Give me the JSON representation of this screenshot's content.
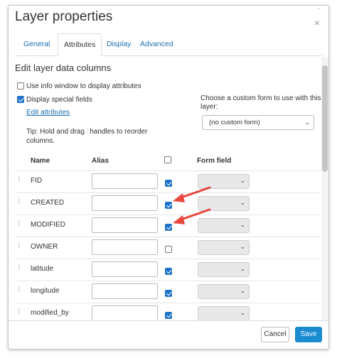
{
  "dialog": {
    "title": "Layer properties",
    "minimize_glyph": "ˆ",
    "close_glyph": "×"
  },
  "tabs": [
    {
      "label": "General",
      "active": false
    },
    {
      "label": "Attributes",
      "active": true
    },
    {
      "label": "Display",
      "active": false
    },
    {
      "label": "Advanced",
      "active": false
    }
  ],
  "section": {
    "heading": "Edit layer data columns",
    "use_info_window": {
      "label": "Use info window to display attributes",
      "checked": false
    },
    "display_special_fields": {
      "label": "Display special fields",
      "checked": true
    },
    "edit_attributes_link": "Edit attributes",
    "tip_before": "Tip: Hold and drag",
    "tip_after": "handles to reorder columns.",
    "custom_form_label": "Choose a custom form to use with this layer:",
    "custom_form_value": "(no custom form)"
  },
  "table": {
    "headers": {
      "name": "Name",
      "alias": "Alias",
      "form_field": "Form field"
    },
    "header_visible_all_checked": false,
    "rows": [
      {
        "name": "FID",
        "visible": true
      },
      {
        "name": "CREATED",
        "visible": true
      },
      {
        "name": "MODIFIED",
        "visible": true
      },
      {
        "name": "OWNER",
        "visible": false
      },
      {
        "name": "latitude",
        "visible": true
      },
      {
        "name": "longitude",
        "visible": true
      },
      {
        "name": "modified_by",
        "visible": true
      }
    ]
  },
  "footer": {
    "cancel_label": "Cancel",
    "save_label": "Save"
  },
  "colors": {
    "accent": "#1a8bd0",
    "link": "#1a6fb0",
    "annotation_arrow": "#e8453c"
  },
  "icons": {
    "drag_handle": "grip-icon",
    "caret": "chevron-down-icon"
  }
}
